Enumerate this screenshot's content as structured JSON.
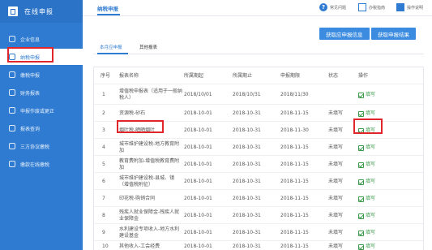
{
  "sidebar": {
    "title": "在线申报",
    "items": [
      {
        "label": "企业信息",
        "icon": "gear-icon"
      },
      {
        "label": "纳税申报",
        "icon": "doc-icon"
      },
      {
        "label": "缴税申报",
        "icon": "tax-icon"
      },
      {
        "label": "财务报表",
        "icon": "report-icon"
      },
      {
        "label": "申报作废或更正",
        "icon": "edit-icon"
      },
      {
        "label": "报表查询",
        "icon": "search-icon"
      },
      {
        "label": "三方协议缴税",
        "icon": "agreement-icon"
      },
      {
        "label": "缴款在线缴税",
        "icon": "pay-icon"
      }
    ]
  },
  "header": {
    "title": "纳税申报",
    "tools": [
      "常见问题",
      "办税指南",
      "操作说明"
    ]
  },
  "actions": {
    "get_info": "获取应申报信息",
    "get_result": "获取申报结果"
  },
  "tabs": [
    "本月应申报",
    "其他报表"
  ],
  "table": {
    "columns": [
      "序号",
      "报表名称",
      "所属期起",
      "所属期止",
      "申报期限",
      "状态",
      "操作"
    ],
    "action_label": "填写",
    "rows": [
      {
        "no": "1",
        "name": "增值税申报表（适用于一般纳税人）",
        "start": "2018/10/01",
        "end": "2018/10/31",
        "deadline": "2018/11/30",
        "status": ""
      },
      {
        "no": "2",
        "name": "资源税-砂石",
        "start": "2018-10-01",
        "end": "2018-10-31",
        "deadline": "2018-11-15",
        "status": "未填写"
      },
      {
        "no": "3",
        "name": "烟叶税-晒晒烟叶",
        "start": "2018-10-01",
        "end": "2018-10-31",
        "deadline": "2018-11-30",
        "status": "未填写"
      },
      {
        "no": "4",
        "name": "城市维护建设税-地方教育附加",
        "start": "2018-10-01",
        "end": "2018-10-31",
        "deadline": "2018-11-15",
        "status": "未填写"
      },
      {
        "no": "5",
        "name": "教育费附加-增值税教育费附加",
        "start": "2018-10-01",
        "end": "2018-10-31",
        "deadline": "2018-11-15",
        "status": "未填写"
      },
      {
        "no": "6",
        "name": "城市维护建设税-县城、镇（增值税附征）",
        "start": "2018-10-01",
        "end": "2018-10-31",
        "deadline": "2018-11-15",
        "status": "未填写"
      },
      {
        "no": "7",
        "name": "印花税-购销合同",
        "start": "2018-10-01",
        "end": "2018-10-31",
        "deadline": "2018-11-15",
        "status": "未填写"
      },
      {
        "no": "8",
        "name": "残疾人就业保障金-残疾人就业保障金",
        "start": "2018-10-01",
        "end": "2018-10-31",
        "deadline": "2018-11-15",
        "status": "未填写"
      },
      {
        "no": "9",
        "name": "水利建设专项收入-地方水利建设基金",
        "start": "2018-10-01",
        "end": "2018-10-31",
        "deadline": "2018-11-15",
        "status": "未填写"
      },
      {
        "no": "10",
        "name": "其他收入-工会经费",
        "start": "2018-10-01",
        "end": "2018-10-31",
        "deadline": "2018-11-15",
        "status": "未填写"
      }
    ]
  },
  "colors": {
    "primary": "#2f7bd1",
    "highlight": "#e0262b",
    "action": "#3a9a4a"
  }
}
